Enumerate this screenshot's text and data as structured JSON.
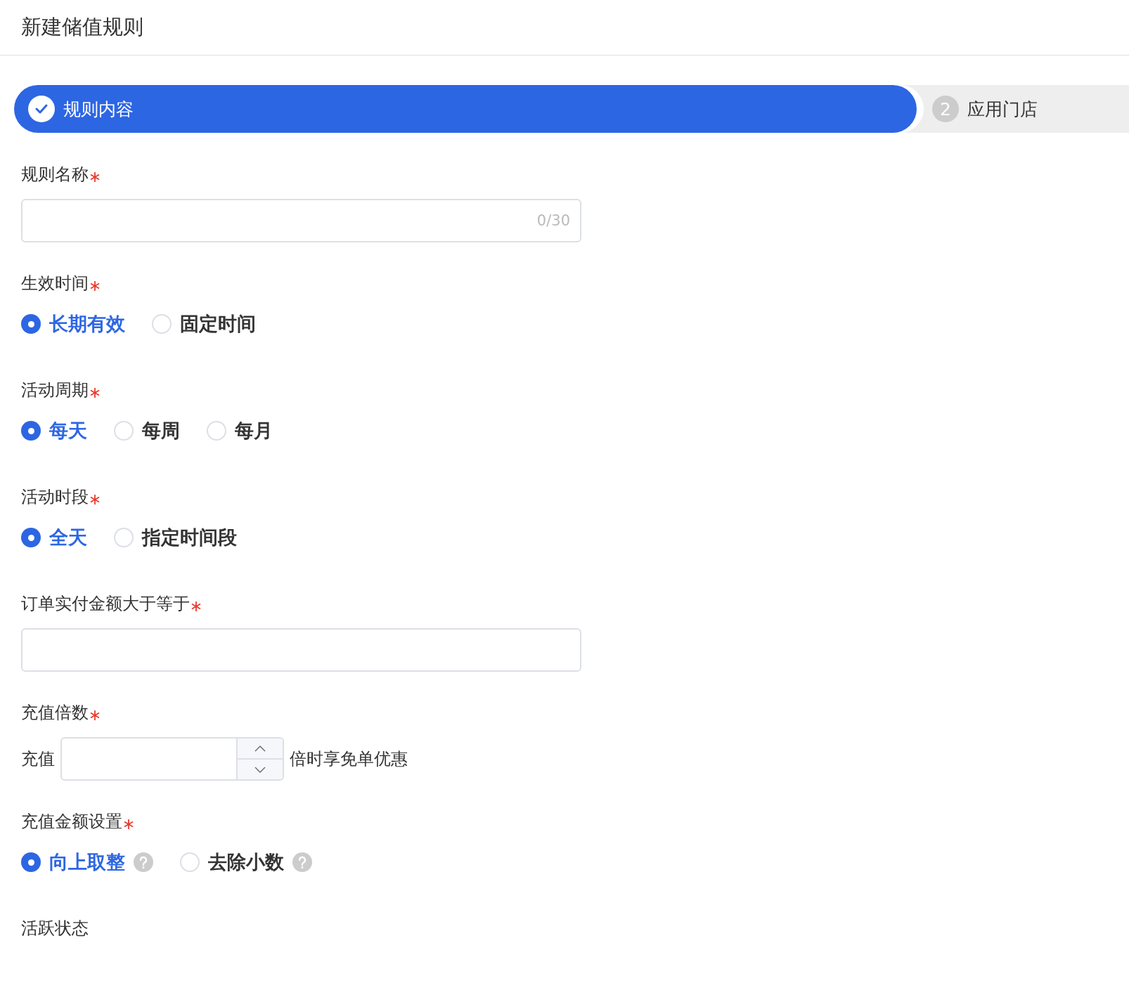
{
  "title": "新建储值规则",
  "steps": [
    {
      "label": "规则内容",
      "selected": true,
      "done": true
    },
    {
      "number": "2",
      "label": "应用门店",
      "selected": false,
      "done": false
    }
  ],
  "fields": [
    {
      "kind": "text",
      "label": "规则名称",
      "required": true,
      "counter": "0/30"
    },
    {
      "kind": "radio",
      "label": "生效时间",
      "required": true,
      "options": [
        {
          "label": "长期有效",
          "selected": true,
          "help": false
        },
        {
          "label": "固定时间",
          "selected": false,
          "help": false
        }
      ]
    },
    {
      "kind": "radio",
      "label": "活动周期",
      "required": true,
      "options": [
        {
          "label": "每天",
          "selected": true,
          "help": false
        },
        {
          "label": "每周",
          "selected": false,
          "help": false
        },
        {
          "label": "每月",
          "selected": false,
          "help": false
        }
      ]
    },
    {
      "kind": "radio",
      "label": "活动时段",
      "required": true,
      "options": [
        {
          "label": "全天",
          "selected": true,
          "help": false
        },
        {
          "label": "指定时间段",
          "selected": false,
          "help": false
        }
      ]
    },
    {
      "kind": "text",
      "label": "订单实付金额大于等于",
      "required": true
    },
    {
      "kind": "number",
      "label": "充值倍数",
      "required": true,
      "prefix": "充值",
      "suffix": "倍时享免单优惠"
    },
    {
      "kind": "radio",
      "label": "充值金额设置",
      "required": true,
      "options": [
        {
          "label": "向上取整",
          "selected": true,
          "help": true
        },
        {
          "label": "去除小数",
          "selected": false,
          "help": true
        }
      ]
    },
    {
      "kind": "label",
      "label": "活跃状态",
      "required": false
    }
  ]
}
